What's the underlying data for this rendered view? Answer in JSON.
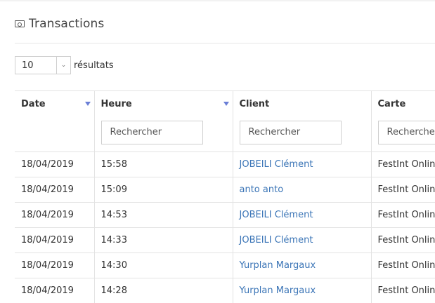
{
  "header": {
    "title": "Transactions",
    "icon": "money-icon"
  },
  "length_control": {
    "selected": "10",
    "suffix": "résultats"
  },
  "table": {
    "columns": [
      "Date",
      "Heure",
      "Client",
      "Carte"
    ],
    "search_placeholder": "Rechercher",
    "rows": [
      {
        "date": "18/04/2019",
        "time": "15:58",
        "client": "JOBEILI Clément",
        "card": "FestInt Online"
      },
      {
        "date": "18/04/2019",
        "time": "15:09",
        "client": "anto anto",
        "card": "FestInt Online"
      },
      {
        "date": "18/04/2019",
        "time": "14:53",
        "client": "JOBEILI Clément",
        "card": "FestInt Online"
      },
      {
        "date": "18/04/2019",
        "time": "14:33",
        "client": "JOBEILI Clément",
        "card": "FestInt Online"
      },
      {
        "date": "18/04/2019",
        "time": "14:30",
        "client": "Yurplan Margaux",
        "card": "FestInt Online"
      },
      {
        "date": "18/04/2019",
        "time": "14:28",
        "client": "Yurplan Margaux",
        "card": "FestInt Online"
      }
    ]
  },
  "colors": {
    "link": "#3a74b6",
    "sort_arrow": "#6b7fd6"
  }
}
